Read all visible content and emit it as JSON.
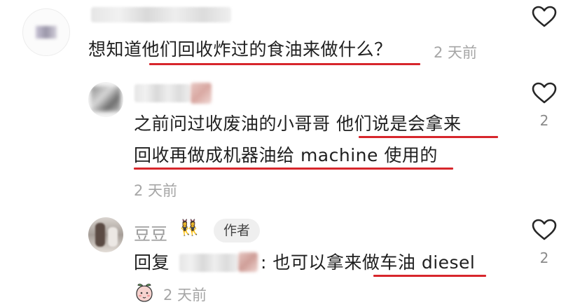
{
  "comments": [
    {
      "text_before": "想知道",
      "text_highlight": "他们回收炸过的食油来做什么？",
      "time": "2 天前"
    },
    {
      "line1_before": "之前问过收废油的小哥哥 ",
      "line1_highlight": "他们说是会拿来",
      "line2_highlight": "回收再做成机器油给 machine 使用的",
      "time": "2 天前",
      "likes": "2"
    },
    {
      "username": "豆豆",
      "name_emoji": "👯‍♀️",
      "author_badge": "作者",
      "reply_prefix": "回复",
      "reply_before": ": 也可以拿来",
      "reply_highlight": "做车油 diesel",
      "time": "2 天前",
      "likes": "2"
    }
  ],
  "colors": {
    "underline": "#d7262c",
    "meta": "#a6a6a6"
  },
  "icons": [
    "heart-outline-icon",
    "peach-sticker-icon"
  ]
}
